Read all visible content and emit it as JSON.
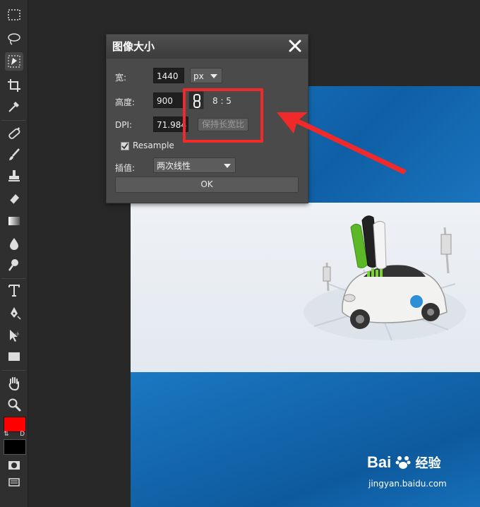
{
  "dialog": {
    "title": "图像大小",
    "width_label": "宽:",
    "width_value": "1440",
    "unit_value": "px",
    "height_label": "高度:",
    "height_value": "900",
    "ratio_text": "8 : 5",
    "dpi_label": "DPI:",
    "dpi_value": "71.984",
    "keep_ratio_button": "保持长宽比",
    "resample_label": "Resample",
    "resample_checked": true,
    "interp_label": "插值:",
    "interp_value": "两次线性",
    "ok_button": "OK"
  },
  "toolbar": {
    "tools": [
      "marquee-icon",
      "lasso-icon",
      "quick-select-icon",
      "crop-icon",
      "eyedropper-icon",
      "healing-icon",
      "brush-icon",
      "stamp-icon",
      "eraser-icon",
      "gradient-icon",
      "blur-icon",
      "dodge-icon",
      "type-icon",
      "pen-icon",
      "path-select-icon",
      "rectangle-icon",
      "hand-icon",
      "zoom-icon"
    ],
    "foreground_color": "#ff0000",
    "background_color": "#000000",
    "swap_label": "⇅",
    "default_label": "D"
  },
  "annotation": {
    "highlight_color": "#f02a2a"
  },
  "watermark": {
    "brand": "Bai",
    "brand2": "经验",
    "url": "jingyan.baidu.com"
  }
}
